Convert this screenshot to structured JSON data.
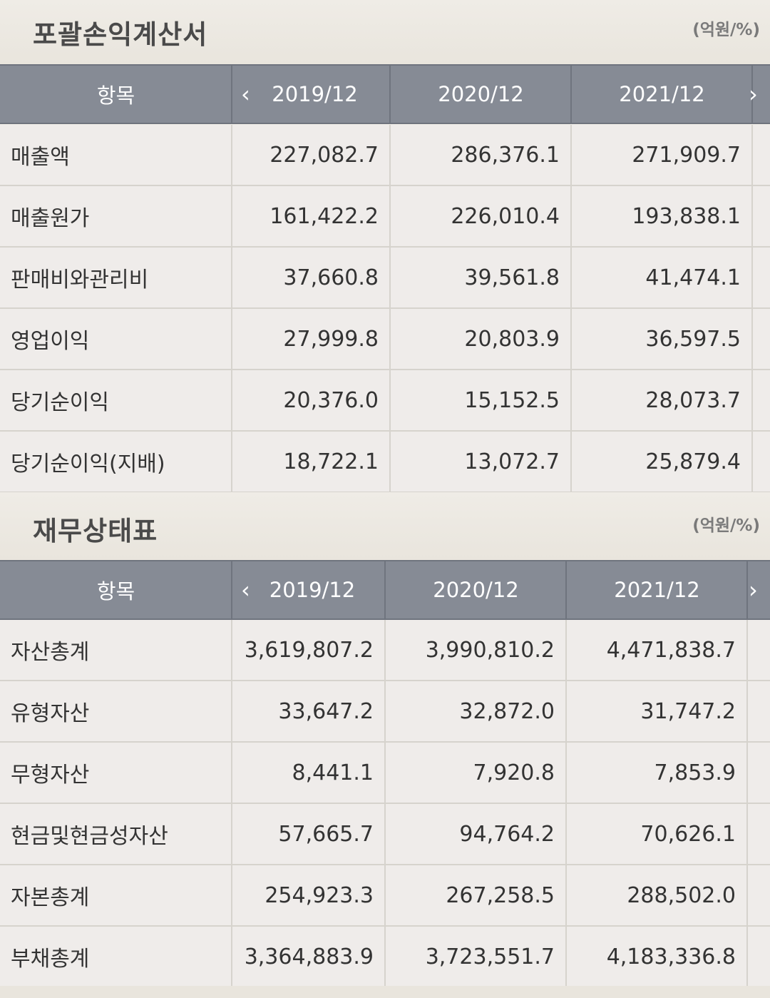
{
  "income_statement": {
    "title": "포괄손익계산서",
    "unit": "(억원/%)",
    "header": {
      "item": "항목",
      "prev_arrow": "‹",
      "next_arrow": "›",
      "periods": [
        "2019/12",
        "2020/12",
        "2021/12"
      ]
    },
    "rows": [
      {
        "label": "매출액",
        "values": [
          "227,082.7",
          "286,376.1",
          "271,909.7"
        ]
      },
      {
        "label": "매출원가",
        "values": [
          "161,422.2",
          "226,010.4",
          "193,838.1"
        ]
      },
      {
        "label": "판매비와관리비",
        "values": [
          "37,660.8",
          "39,561.8",
          "41,474.1"
        ]
      },
      {
        "label": "영업이익",
        "values": [
          "27,999.8",
          "20,803.9",
          "36,597.5"
        ]
      },
      {
        "label": "당기순이익",
        "values": [
          "20,376.0",
          "15,152.5",
          "28,073.7"
        ]
      },
      {
        "label": "당기순이익(지배)",
        "values": [
          "18,722.1",
          "13,072.7",
          "25,879.4"
        ]
      }
    ]
  },
  "balance_sheet": {
    "title": "재무상태표",
    "unit": "(억원/%)",
    "header": {
      "item": "항목",
      "prev_arrow": "‹",
      "next_arrow": "›",
      "periods": [
        "2019/12",
        "2020/12",
        "2021/12"
      ]
    },
    "rows": [
      {
        "label": "자산총계",
        "values": [
          "3,619,807.2",
          "3,990,810.2",
          "4,471,838.7"
        ]
      },
      {
        "label": "유형자산",
        "values": [
          "33,647.2",
          "32,872.0",
          "31,747.2"
        ]
      },
      {
        "label": "무형자산",
        "values": [
          "8,441.1",
          "7,920.8",
          "7,853.9"
        ]
      },
      {
        "label": "현금및현금성자산",
        "values": [
          "57,665.7",
          "94,764.2",
          "70,626.1"
        ]
      },
      {
        "label": "자본총계",
        "values": [
          "254,923.3",
          "267,258.5",
          "288,502.0"
        ]
      },
      {
        "label": "부채총계",
        "values": [
          "3,364,883.9",
          "3,723,551.7",
          "4,183,336.8"
        ]
      }
    ]
  }
}
